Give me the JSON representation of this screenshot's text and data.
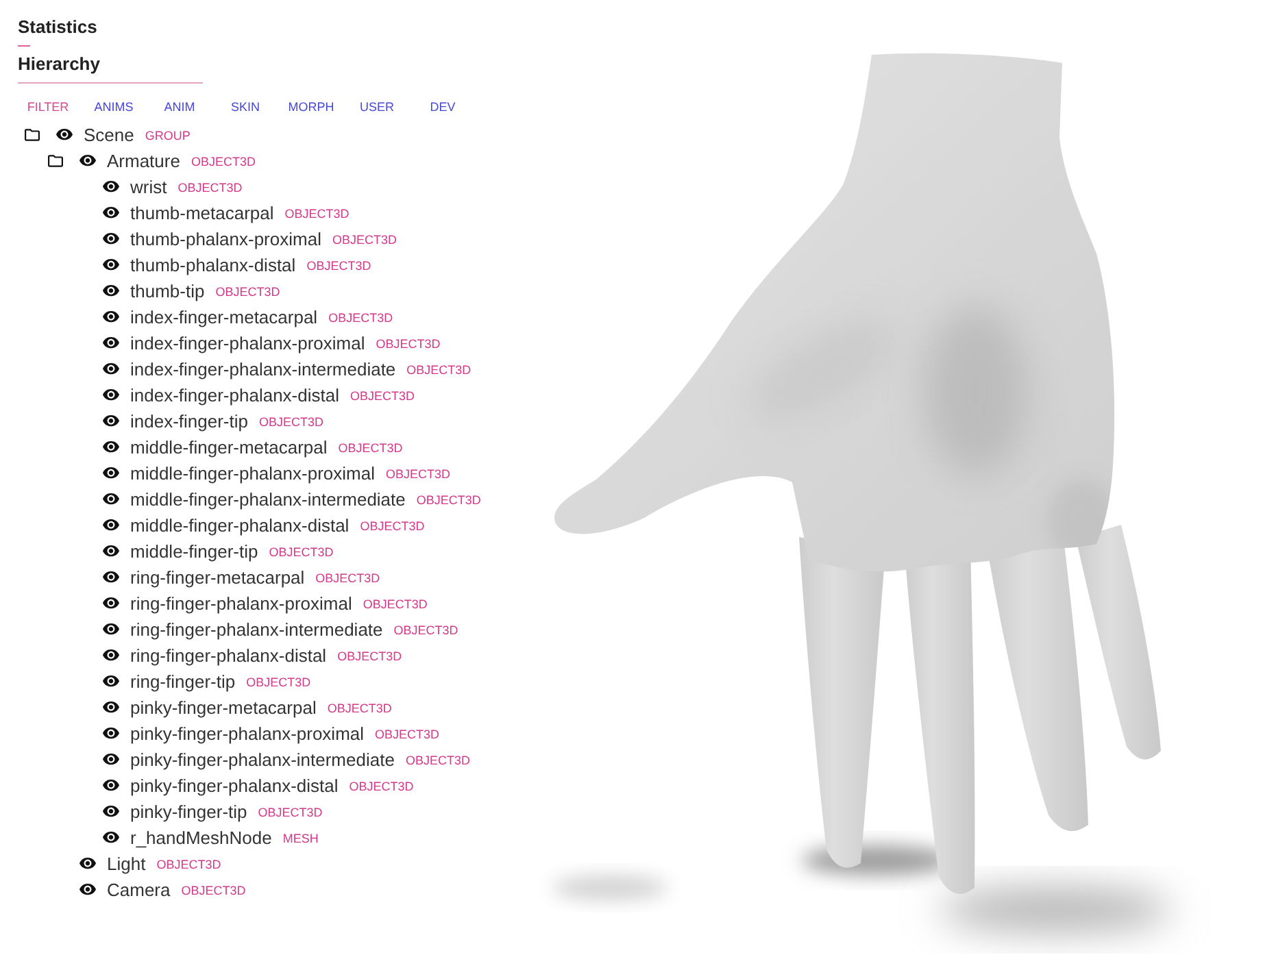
{
  "sections": [
    {
      "title": "Statistics",
      "expanded": false
    },
    {
      "title": "Hierarchy",
      "expanded": true
    }
  ],
  "filters": [
    {
      "label": "FILTER",
      "selected": true
    },
    {
      "label": "ANIMS",
      "selected": false
    },
    {
      "label": "ANIM",
      "selected": false
    },
    {
      "label": "SKIN",
      "selected": false
    },
    {
      "label": "MORPH",
      "selected": false
    },
    {
      "label": "USER",
      "selected": false
    },
    {
      "label": "DEV",
      "selected": false
    }
  ],
  "tree": [
    {
      "name": "Scene",
      "type": "GROUP",
      "visible": true,
      "children": [
        {
          "name": "Armature",
          "type": "OBJECT3D",
          "visible": true,
          "children": [
            {
              "name": "wrist",
              "type": "OBJECT3D",
              "visible": true
            },
            {
              "name": "thumb-metacarpal",
              "type": "OBJECT3D",
              "visible": true
            },
            {
              "name": "thumb-phalanx-proximal",
              "type": "OBJECT3D",
              "visible": true
            },
            {
              "name": "thumb-phalanx-distal",
              "type": "OBJECT3D",
              "visible": true
            },
            {
              "name": "thumb-tip",
              "type": "OBJECT3D",
              "visible": true
            },
            {
              "name": "index-finger-metacarpal",
              "type": "OBJECT3D",
              "visible": true
            },
            {
              "name": "index-finger-phalanx-proximal",
              "type": "OBJECT3D",
              "visible": true
            },
            {
              "name": "index-finger-phalanx-intermediate",
              "type": "OBJECT3D",
              "visible": true
            },
            {
              "name": "index-finger-phalanx-distal",
              "type": "OBJECT3D",
              "visible": true
            },
            {
              "name": "index-finger-tip",
              "type": "OBJECT3D",
              "visible": true
            },
            {
              "name": "middle-finger-metacarpal",
              "type": "OBJECT3D",
              "visible": true
            },
            {
              "name": "middle-finger-phalanx-proximal",
              "type": "OBJECT3D",
              "visible": true
            },
            {
              "name": "middle-finger-phalanx-intermediate",
              "type": "OBJECT3D",
              "visible": true
            },
            {
              "name": "middle-finger-phalanx-distal",
              "type": "OBJECT3D",
              "visible": true
            },
            {
              "name": "middle-finger-tip",
              "type": "OBJECT3D",
              "visible": true
            },
            {
              "name": "ring-finger-metacarpal",
              "type": "OBJECT3D",
              "visible": true
            },
            {
              "name": "ring-finger-phalanx-proximal",
              "type": "OBJECT3D",
              "visible": true
            },
            {
              "name": "ring-finger-phalanx-intermediate",
              "type": "OBJECT3D",
              "visible": true
            },
            {
              "name": "ring-finger-phalanx-distal",
              "type": "OBJECT3D",
              "visible": true
            },
            {
              "name": "ring-finger-tip",
              "type": "OBJECT3D",
              "visible": true
            },
            {
              "name": "pinky-finger-metacarpal",
              "type": "OBJECT3D",
              "visible": true
            },
            {
              "name": "pinky-finger-phalanx-proximal",
              "type": "OBJECT3D",
              "visible": true
            },
            {
              "name": "pinky-finger-phalanx-intermediate",
              "type": "OBJECT3D",
              "visible": true
            },
            {
              "name": "pinky-finger-phalanx-distal",
              "type": "OBJECT3D",
              "visible": true
            },
            {
              "name": "pinky-finger-tip",
              "type": "OBJECT3D",
              "visible": true
            },
            {
              "name": "r_handMeshNode",
              "type": "MESH",
              "visible": true
            }
          ]
        },
        {
          "name": "Light",
          "type": "OBJECT3D",
          "visible": true
        },
        {
          "name": "Camera",
          "type": "OBJECT3D",
          "visible": true
        }
      ]
    }
  ]
}
